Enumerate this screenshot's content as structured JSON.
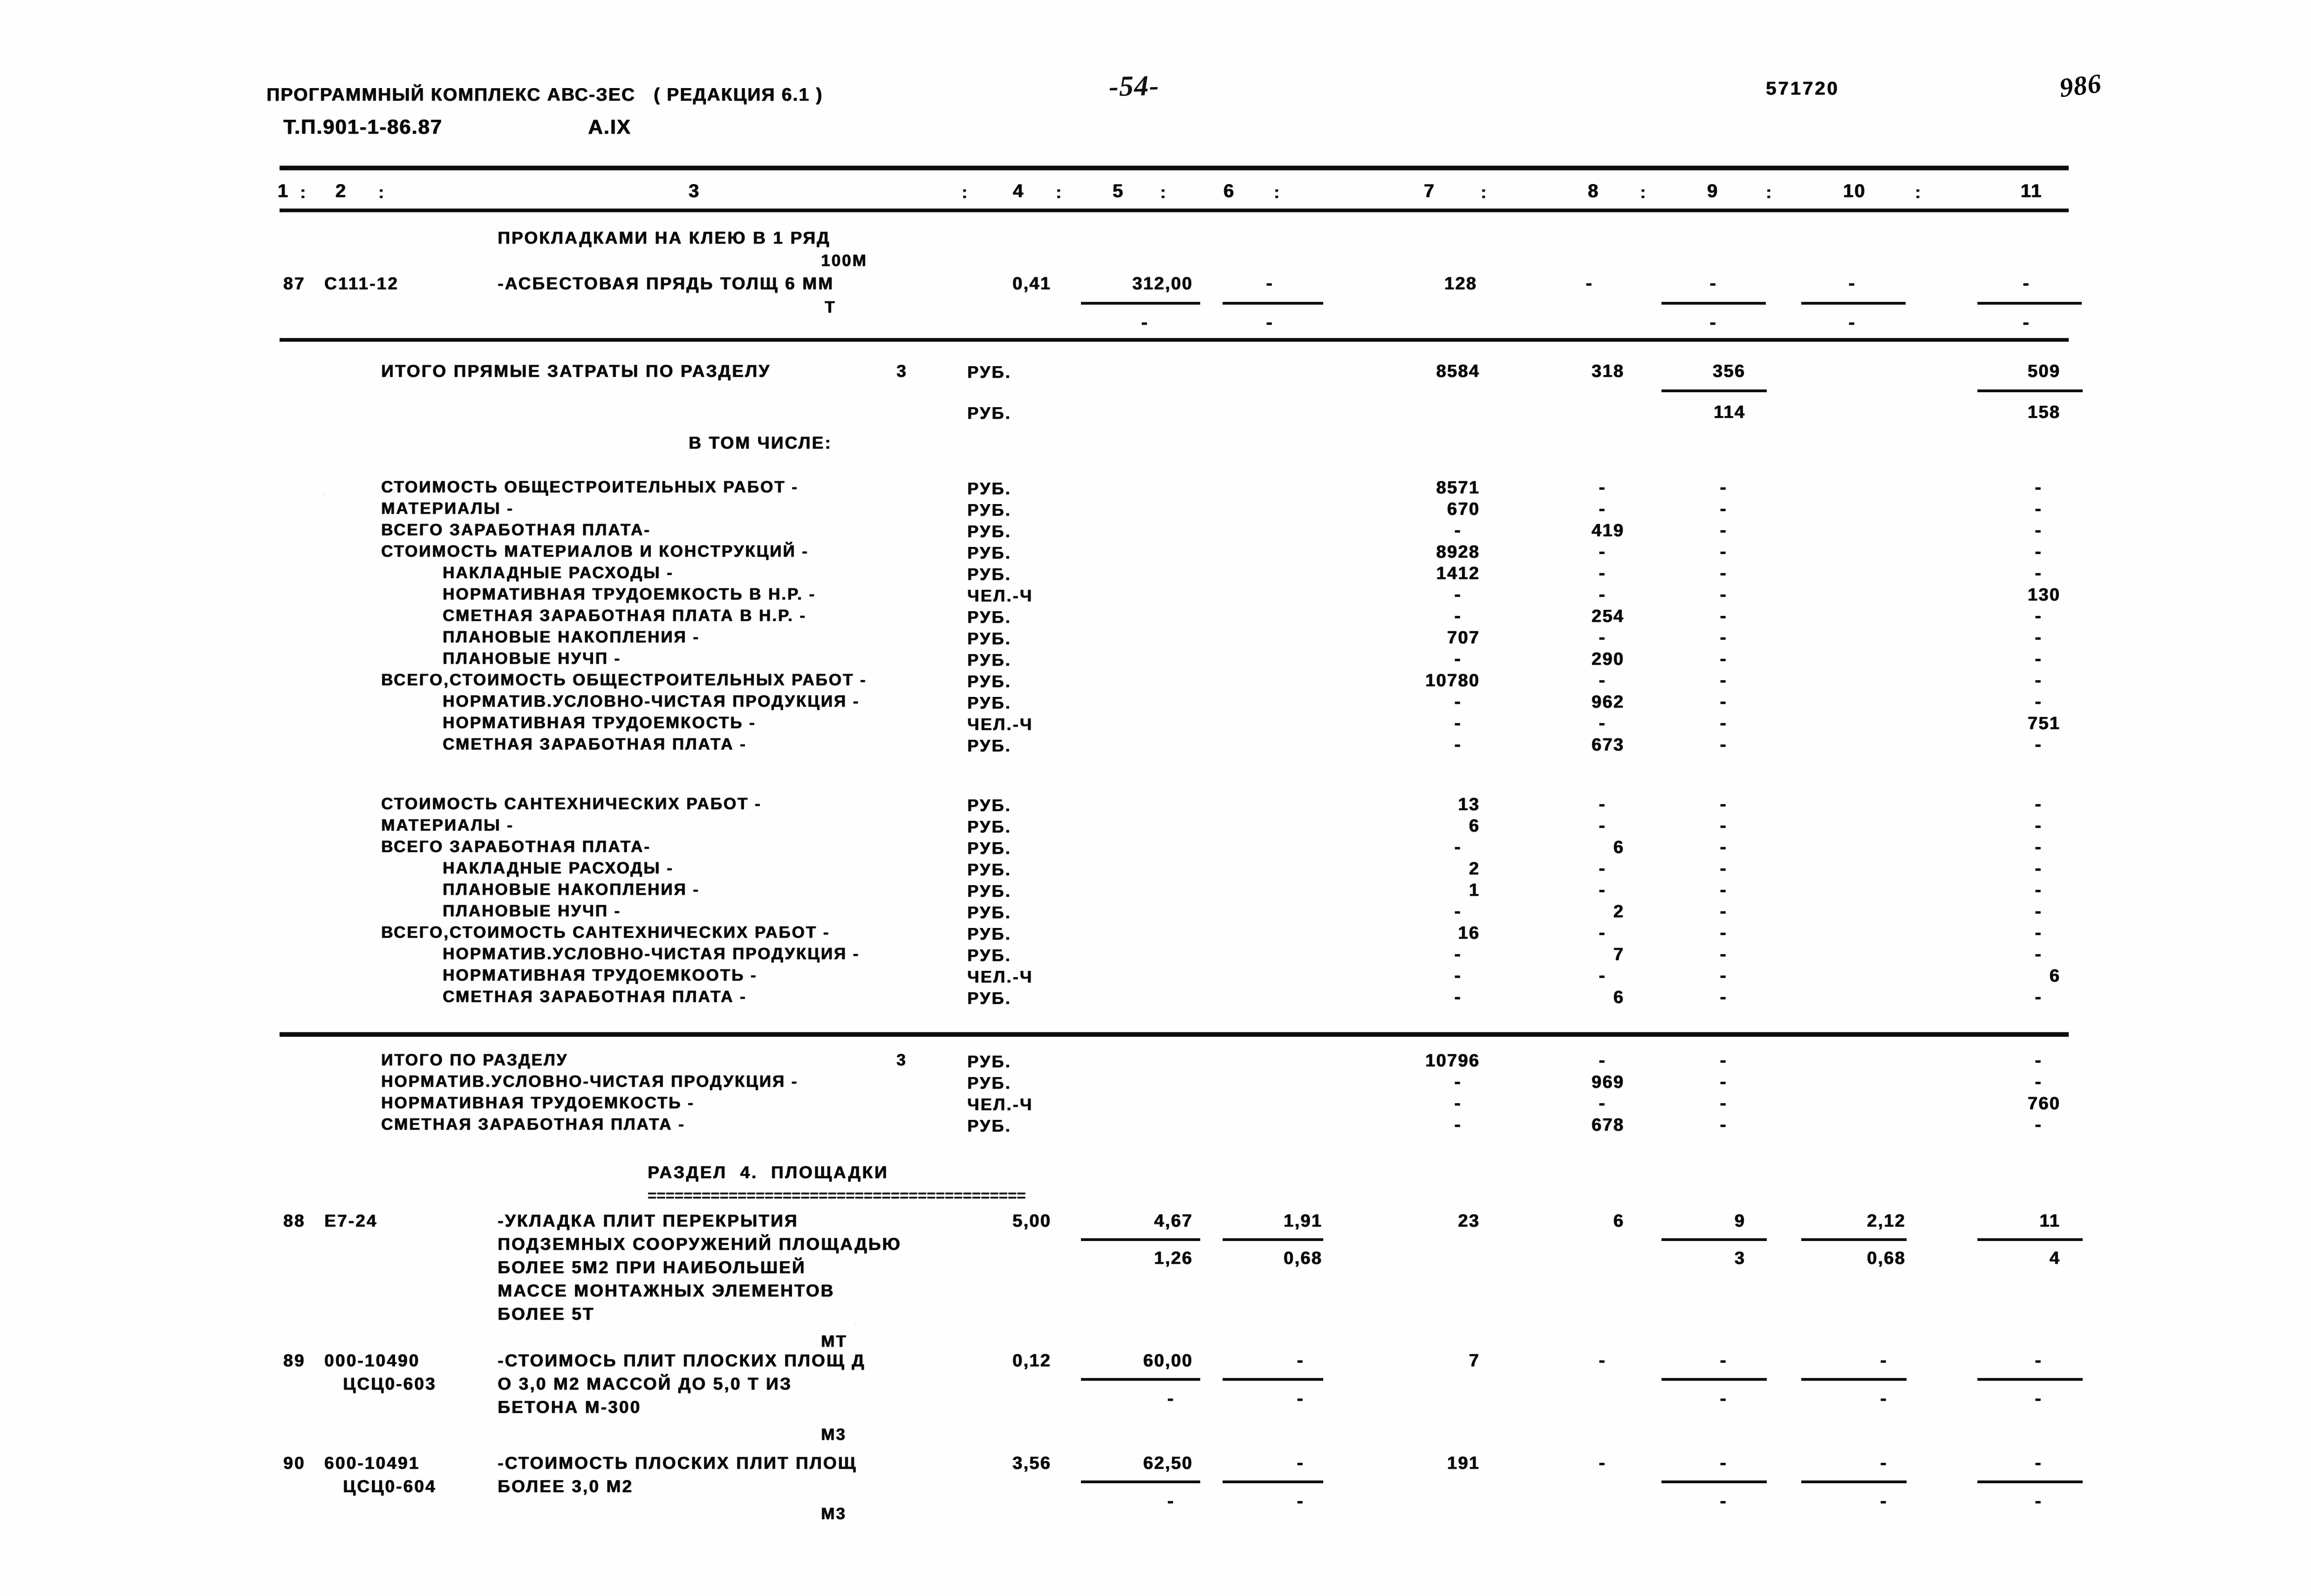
{
  "header": {
    "program_title": "ПРОГРАММНЫЙ КОМПЛЕКС АВС-ЗЕС   ( РЕДАКЦИЯ 6.1 )",
    "project_code": "Т.П.901-1-86.87",
    "section_code": "А.IX",
    "page_number": "-54-",
    "doc_number": "571720",
    "hand_mark": "986"
  },
  "column_headers": [
    "1",
    "2",
    "3",
    "4",
    "5",
    "6",
    "7",
    "8",
    "9",
    "10",
    "11"
  ],
  "column_separator": ":",
  "rows": {
    "item87": {
      "no": "87",
      "code": "С111-12",
      "desc_line0": "ПРОКЛАДКАМИ НА КЛЕЮ В 1 РЯД",
      "desc_unit_top": "100М",
      "desc_line1": "-АСБЕСТОВАЯ ПРЯДЬ ТОЛЩ 6 ММ",
      "desc_unit_bottom": "Т",
      "c4": "0,41",
      "c5": "312,00",
      "c6": "-",
      "c7": "128",
      "c8": "-",
      "c9": "-",
      "c10": "-",
      "c11": "-",
      "c5b": "-",
      "c6b": "-",
      "c9b": "-",
      "c10b": "-",
      "c11b": "-"
    },
    "totals_direct": {
      "label": "ИТОГО ПРЯМЫЕ ЗАТРАТЫ ПО РАЗДЕЛУ",
      "section": "3",
      "unit": "РУБ.",
      "unit2": "РУБ.",
      "c7": "8584",
      "c8": "318",
      "c9": "356",
      "c11": "509",
      "c9b": "114",
      "c11b": "158"
    },
    "in_which": "В ТОМ ЧИСЛЕ:"
  },
  "general_works": {
    "title": "СТОИМОСТЬ ОБЩЕСТРОИТЕЛЬНЫХ РАБОТ -",
    "lines": [
      {
        "label": "СТОИМОСТЬ ОБЩЕСТРОИТЕЛЬНЫХ РАБОТ -",
        "indent": 0,
        "unit": "РУБ.",
        "c7": "8571",
        "c8": "-",
        "c9": "-",
        "c11": "-"
      },
      {
        "label": "МАТЕРИАЛЫ -",
        "indent": 0,
        "unit": "РУБ.",
        "c7": "670",
        "c8": "-",
        "c9": "-",
        "c11": "-"
      },
      {
        "label": "ВСЕГО ЗАРАБОТНАЯ ПЛАТА-",
        "indent": 0,
        "unit": "РУБ.",
        "c7": "-",
        "c8": "419",
        "c9": "-",
        "c11": "-"
      },
      {
        "label": "СТОИМОСТЬ МАТЕРИАЛОВ И КОНСТРУКЦИЙ -",
        "indent": 0,
        "unit": "РУБ.",
        "c7": "8928",
        "c8": "-",
        "c9": "-",
        "c11": "-"
      },
      {
        "label": "НАКЛАДНЫЕ РАСХОДЫ -",
        "indent": 1,
        "unit": "РУБ.",
        "c7": "1412",
        "c8": "-",
        "c9": "-",
        "c11": "-"
      },
      {
        "label": "НОРМАТИВНАЯ ТРУДОЕМКОСТЬ В Н.Р. -",
        "indent": 1,
        "unit": "ЧЕЛ.-Ч",
        "c7": "-",
        "c8": "-",
        "c9": "-",
        "c11": "130"
      },
      {
        "label": "СМЕТНАЯ ЗАРАБОТНАЯ ПЛАТА В Н.Р. -",
        "indent": 1,
        "unit": "РУБ.",
        "c7": "-",
        "c8": "254",
        "c9": "-",
        "c11": "-"
      },
      {
        "label": "ПЛАНОВЫЕ НАКОПЛЕНИЯ -",
        "indent": 1,
        "unit": "РУБ.",
        "c7": "707",
        "c8": "-",
        "c9": "-",
        "c11": "-"
      },
      {
        "label": "ПЛАНОВЫЕ НУЧП -",
        "indent": 1,
        "unit": "РУБ.",
        "c7": "-",
        "c8": "290",
        "c9": "-",
        "c11": "-"
      },
      {
        "label": "ВСЕГО,СТОИМОСТЬ ОБЩЕСТРОИТЕЛЬНЫХ РАБОТ -",
        "indent": 0,
        "unit": "РУБ.",
        "c7": "10780",
        "c8": "-",
        "c9": "-",
        "c11": "-"
      },
      {
        "label": "НОРМАТИВ.УСЛОВНО-ЧИСТАЯ ПРОДУКЦИЯ -",
        "indent": 1,
        "unit": "РУБ.",
        "c7": "-",
        "c8": "962",
        "c9": "-",
        "c11": "-"
      },
      {
        "label": "НОРМАТИВНАЯ ТРУДОЕМКОСТЬ -",
        "indent": 1,
        "unit": "ЧЕЛ.-Ч",
        "c7": "-",
        "c8": "-",
        "c9": "-",
        "c11": "751"
      },
      {
        "label": "СМЕТНАЯ ЗАРАБОТНАЯ ПЛАТА -",
        "indent": 1,
        "unit": "РУБ.",
        "c7": "-",
        "c8": "673",
        "c9": "-",
        "c11": "-"
      }
    ]
  },
  "sanitary_works": {
    "lines": [
      {
        "label": "СТОИМОСТЬ САНТЕХНИЧЕСКИХ РАБОТ -",
        "indent": 0,
        "unit": "РУБ.",
        "c7": "13",
        "c8": "-",
        "c9": "-",
        "c11": "-"
      },
      {
        "label": "МАТЕРИАЛЫ -",
        "indent": 0,
        "unit": "РУБ.",
        "c7": "6",
        "c8": "-",
        "c9": "-",
        "c11": "-"
      },
      {
        "label": "ВСЕГО ЗАРАБОТНАЯ ПЛАТА-",
        "indent": 0,
        "unit": "РУБ.",
        "c7": "-",
        "c8": "6",
        "c9": "-",
        "c11": "-"
      },
      {
        "label": "НАКЛАДНЫЕ РАСХОДЫ -",
        "indent": 1,
        "unit": "РУБ.",
        "c7": "2",
        "c8": "-",
        "c9": "-",
        "c11": "-"
      },
      {
        "label": "ПЛАНОВЫЕ НАКОПЛЕНИЯ -",
        "indent": 1,
        "unit": "РУБ.",
        "c7": "1",
        "c8": "-",
        "c9": "-",
        "c11": "-"
      },
      {
        "label": "ПЛАНОВЫЕ НУЧП -",
        "indent": 1,
        "unit": "РУБ.",
        "c7": "-",
        "c8": "2",
        "c9": "-",
        "c11": "-"
      },
      {
        "label": "ВСЕГО,СТОИМОСТЬ САНТЕХНИЧЕСКИХ РАБОТ -",
        "indent": 0,
        "unit": "РУБ.",
        "c7": "16",
        "c8": "-",
        "c9": "-",
        "c11": "-"
      },
      {
        "label": "НОРМАТИВ.УСЛОВНО-ЧИСТАЯ ПРОДУКЦИЯ -",
        "indent": 1,
        "unit": "РУБ.",
        "c7": "-",
        "c8": "7",
        "c9": "-",
        "c11": "-"
      },
      {
        "label": "НОРМАТИВНАЯ ТРУДОЕМКООТЬ -",
        "indent": 1,
        "unit": "ЧЕЛ.-Ч",
        "c7": "-",
        "c8": "-",
        "c9": "-",
        "c11": "6"
      },
      {
        "label": "СМЕТНАЯ ЗАРАБОТНАЯ ПЛАТА -",
        "indent": 1,
        "unit": "РУБ.",
        "c7": "-",
        "c8": "6",
        "c9": "-",
        "c11": "-"
      }
    ]
  },
  "section_totals": {
    "lines": [
      {
        "label": "ИТОГО ПО РАЗДЕЛУ",
        "section": "3",
        "indent": 0,
        "unit": "РУБ.",
        "c7": "10796",
        "c8": "-",
        "c9": "-",
        "c11": "-"
      },
      {
        "label": "НОРМАТИВ.УСЛОВНО-ЧИСТАЯ ПРОДУКЦИЯ -",
        "section": "",
        "indent": 0,
        "unit": "РУБ.",
        "c7": "-",
        "c8": "969",
        "c9": "-",
        "c11": "-"
      },
      {
        "label": "НОРМАТИВНАЯ ТРУДОЕМКОСТЬ -",
        "section": "",
        "indent": 0,
        "unit": "ЧЕЛ.-Ч",
        "c7": "-",
        "c8": "-",
        "c9": "-",
        "c11": "760"
      },
      {
        "label": "СМЕТНАЯ ЗАРАБОТНАЯ ПЛАТА -",
        "section": "",
        "indent": 0,
        "unit": "РУБ.",
        "c7": "-",
        "c8": "678",
        "c9": "-",
        "c11": "-"
      }
    ]
  },
  "section4": {
    "title": "РАЗДЕЛ  4.  ПЛОЩАДКИ",
    "rule_chars": "==========================================",
    "items": [
      {
        "no": "88",
        "code": "Е7-24",
        "desc": [
          "-УКЛАДКА ПЛИТ ПЕРЕКРЫТИЯ",
          "ПОДЗЕМНЫХ СООРУЖЕНИЙ ПЛОЩАДЬЮ",
          "БОЛЕЕ 5М2 ПРИ НАИБОЛЬШЕЙ",
          "МАССЕ МОНТАЖНЫХ ЭЛЕМЕНТОВ",
          "БОЛЕЕ 5Т"
        ],
        "unit": "МТ",
        "c4": "5,00",
        "c5": "4,67",
        "c6": "1,91",
        "c7": "23",
        "c8": "6",
        "c9": "9",
        "c10": "2,12",
        "c11": "11",
        "c5b": "1,26",
        "c6b": "0,68",
        "c9b": "3",
        "c10b": "0,68",
        "c11b": "4"
      },
      {
        "no": "89",
        "code": "000-10490",
        "code2": "ЦСЦ0-603",
        "desc": [
          "-СТОИМОСЬ ПЛИТ ПЛОСКИХ ПЛОЩ Д",
          "О 3,0 М2 МАССОЙ ДО 5,0 Т ИЗ",
          "БЕТОНА М-300"
        ],
        "unit": "М3",
        "c4": "0,12",
        "c5": "60,00",
        "c6": "-",
        "c7": "7",
        "c8": "-",
        "c9": "-",
        "c10": "-",
        "c11": "-",
        "c5b": "-",
        "c6b": "-",
        "c9b": "-",
        "c10b": "-",
        "c11b": "-"
      },
      {
        "no": "90",
        "code": "600-10491",
        "code2": "ЦСЦ0-604",
        "desc": [
          "-СТОИМОСТЬ ПЛОСКИХ ПЛИТ ПЛОЩ",
          "БОЛЕЕ 3,0 М2"
        ],
        "unit": "М3",
        "c4": "3,56",
        "c5": "62,50",
        "c6": "-",
        "c7": "191",
        "c8": "-",
        "c9": "-",
        "c10": "-",
        "c11": "-",
        "c5b": "-",
        "c6b": "-",
        "c9b": "-",
        "c10b": "-",
        "c11b": "-"
      }
    ]
  }
}
